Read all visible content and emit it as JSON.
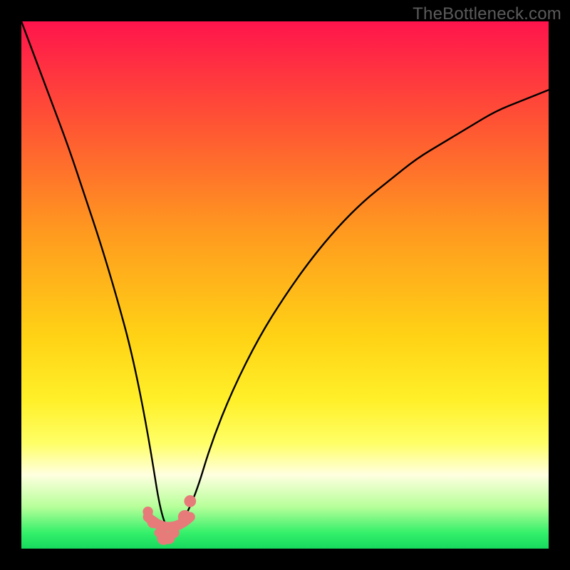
{
  "watermark": "TheBottleneck.com",
  "colors": {
    "frame": "#000000",
    "watermark_text": "#5b5b5b",
    "curve": "#000000",
    "optimum_marker": "#e77b7a",
    "gradient_stops": [
      {
        "offset": 0.0,
        "color": "#ff144c"
      },
      {
        "offset": 0.2,
        "color": "#ff5633"
      },
      {
        "offset": 0.4,
        "color": "#ff9a1f"
      },
      {
        "offset": 0.6,
        "color": "#ffd315"
      },
      {
        "offset": 0.72,
        "color": "#fff02a"
      },
      {
        "offset": 0.8,
        "color": "#ffff66"
      },
      {
        "offset": 0.86,
        "color": "#ffffe0"
      },
      {
        "offset": 0.92,
        "color": "#b8ff9a"
      },
      {
        "offset": 0.97,
        "color": "#34f06a"
      },
      {
        "offset": 1.0,
        "color": "#17d95e"
      }
    ]
  },
  "chart_data": {
    "type": "line",
    "title": "",
    "xlabel": "",
    "ylabel": "",
    "xlim": [
      0,
      100
    ],
    "ylim": [
      0,
      100
    ],
    "grid": false,
    "legend": null,
    "optimum_x": 27,
    "optimum_band": [
      24,
      32
    ],
    "series": [
      {
        "name": "bottleneck-percentage",
        "x": [
          0,
          3,
          6,
          9,
          12,
          15,
          18,
          21,
          24,
          27,
          30,
          33,
          36,
          40,
          45,
          50,
          55,
          60,
          65,
          70,
          75,
          80,
          85,
          90,
          95,
          100
        ],
        "values": [
          100,
          92,
          84,
          76,
          67,
          58,
          48,
          37,
          22,
          3,
          4,
          10,
          20,
          30,
          40,
          48,
          55,
          61,
          66,
          70,
          74,
          77,
          80,
          83,
          85,
          87
        ]
      }
    ],
    "markers": [
      {
        "x": 24,
        "y": 7,
        "r": 1.2
      },
      {
        "x": 25,
        "y": 5,
        "r": 1.4
      },
      {
        "x": 26,
        "y": 3,
        "r": 1.0
      },
      {
        "x": 27,
        "y": 2,
        "r": 1.6
      },
      {
        "x": 28,
        "y": 2,
        "r": 1.4
      },
      {
        "x": 29,
        "y": 3,
        "r": 1.2
      },
      {
        "x": 31,
        "y": 6,
        "r": 1.6
      },
      {
        "x": 32,
        "y": 9,
        "r": 1.4
      }
    ]
  }
}
